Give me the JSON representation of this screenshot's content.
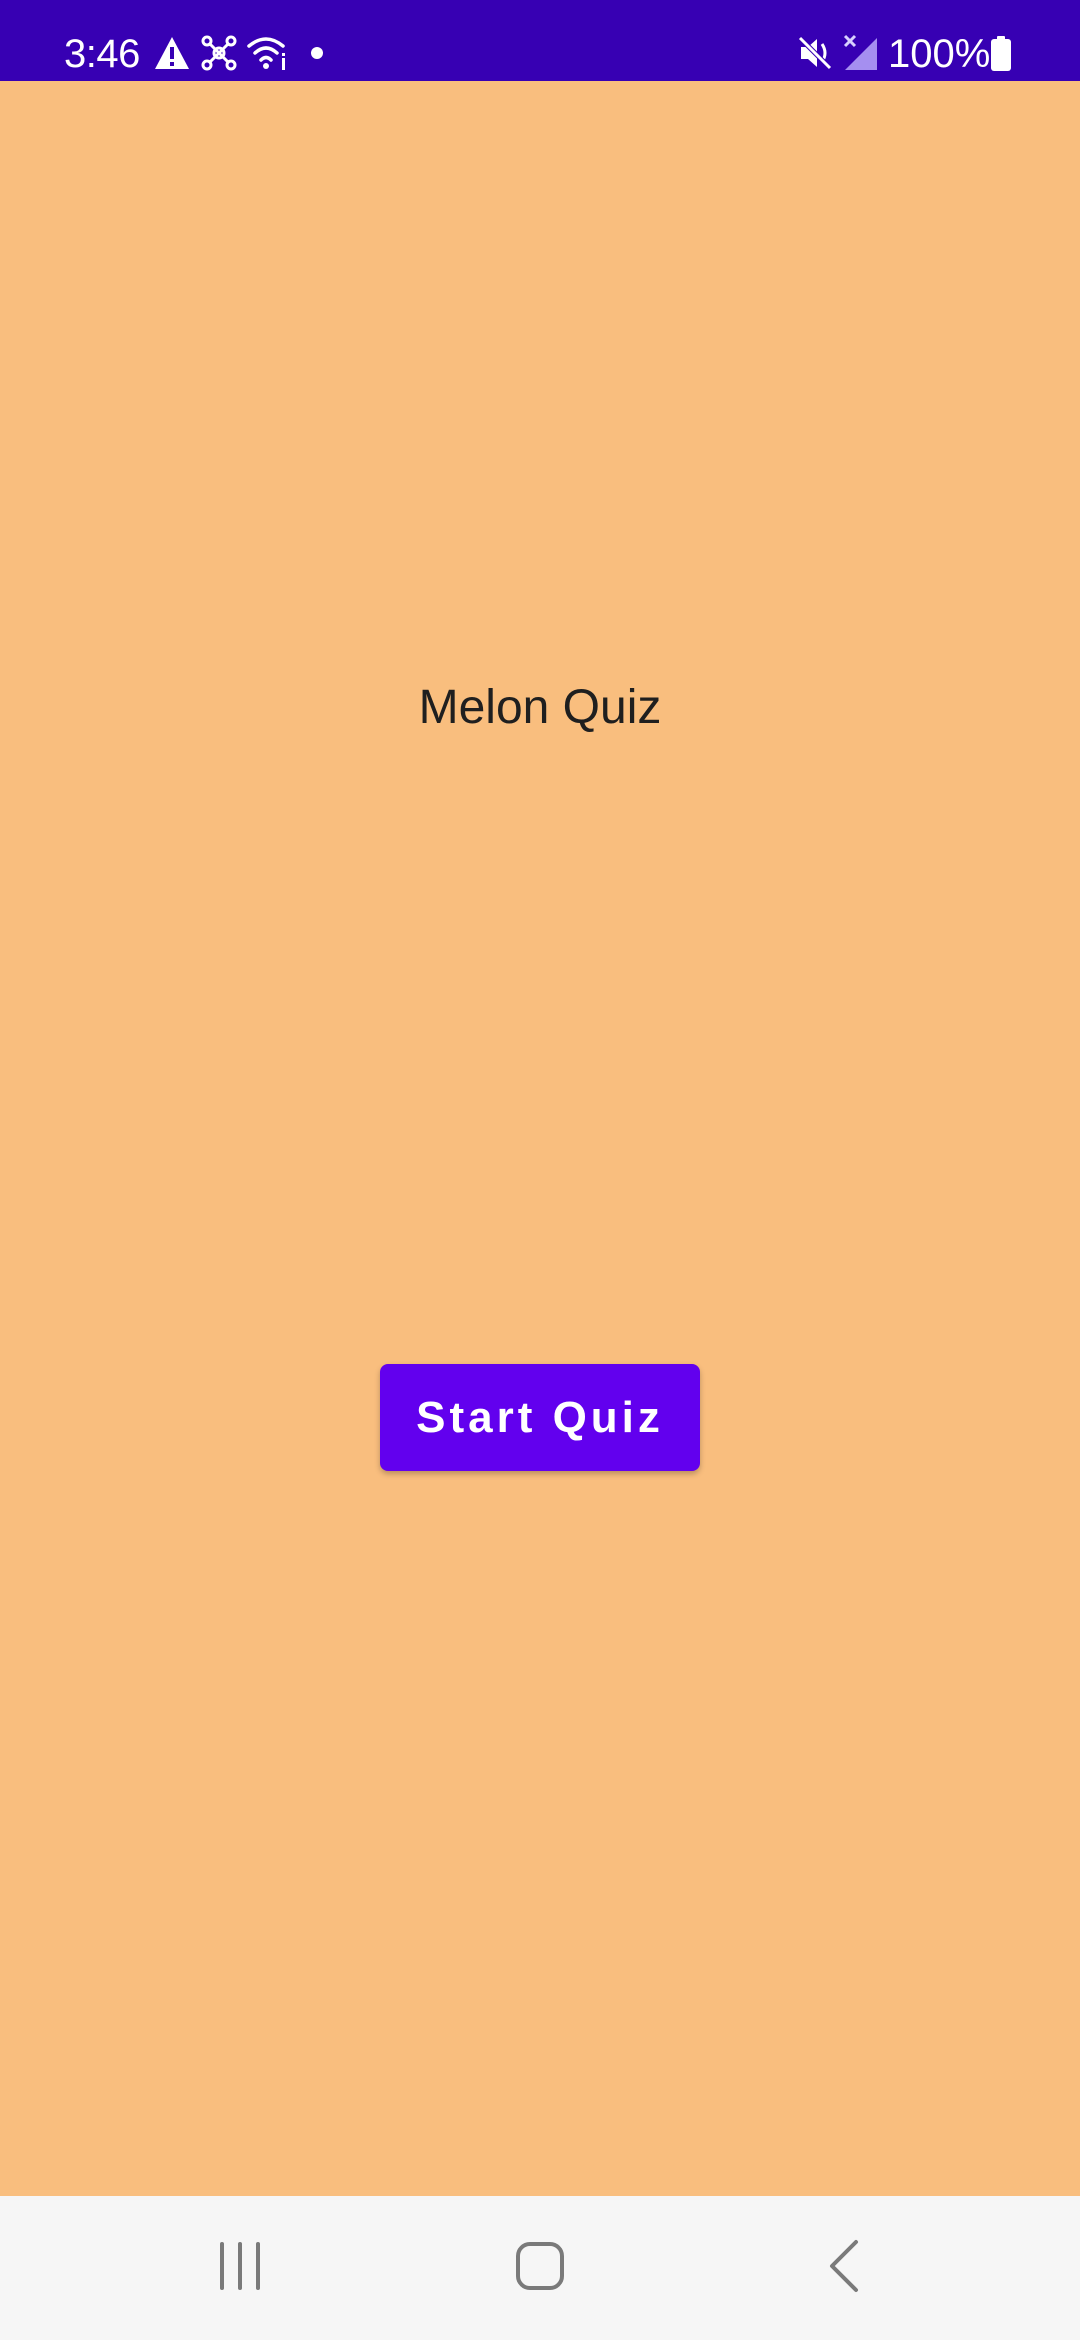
{
  "status_bar": {
    "time": "3:46",
    "battery_percent": "100%",
    "icons": [
      "alert-icon",
      "network-hub-icon",
      "wifi-icon",
      "dot-icon",
      "mute-icon",
      "signal-icon",
      "battery-icon"
    ],
    "background_color": "#3700B3"
  },
  "main": {
    "title": "Melon Quiz",
    "start_button_label": "Start Quiz",
    "background_color": "#F9BE7E",
    "button_color": "#6200EE"
  },
  "nav_bar": {
    "buttons": [
      "recent-apps-icon",
      "home-icon",
      "back-icon"
    ]
  }
}
